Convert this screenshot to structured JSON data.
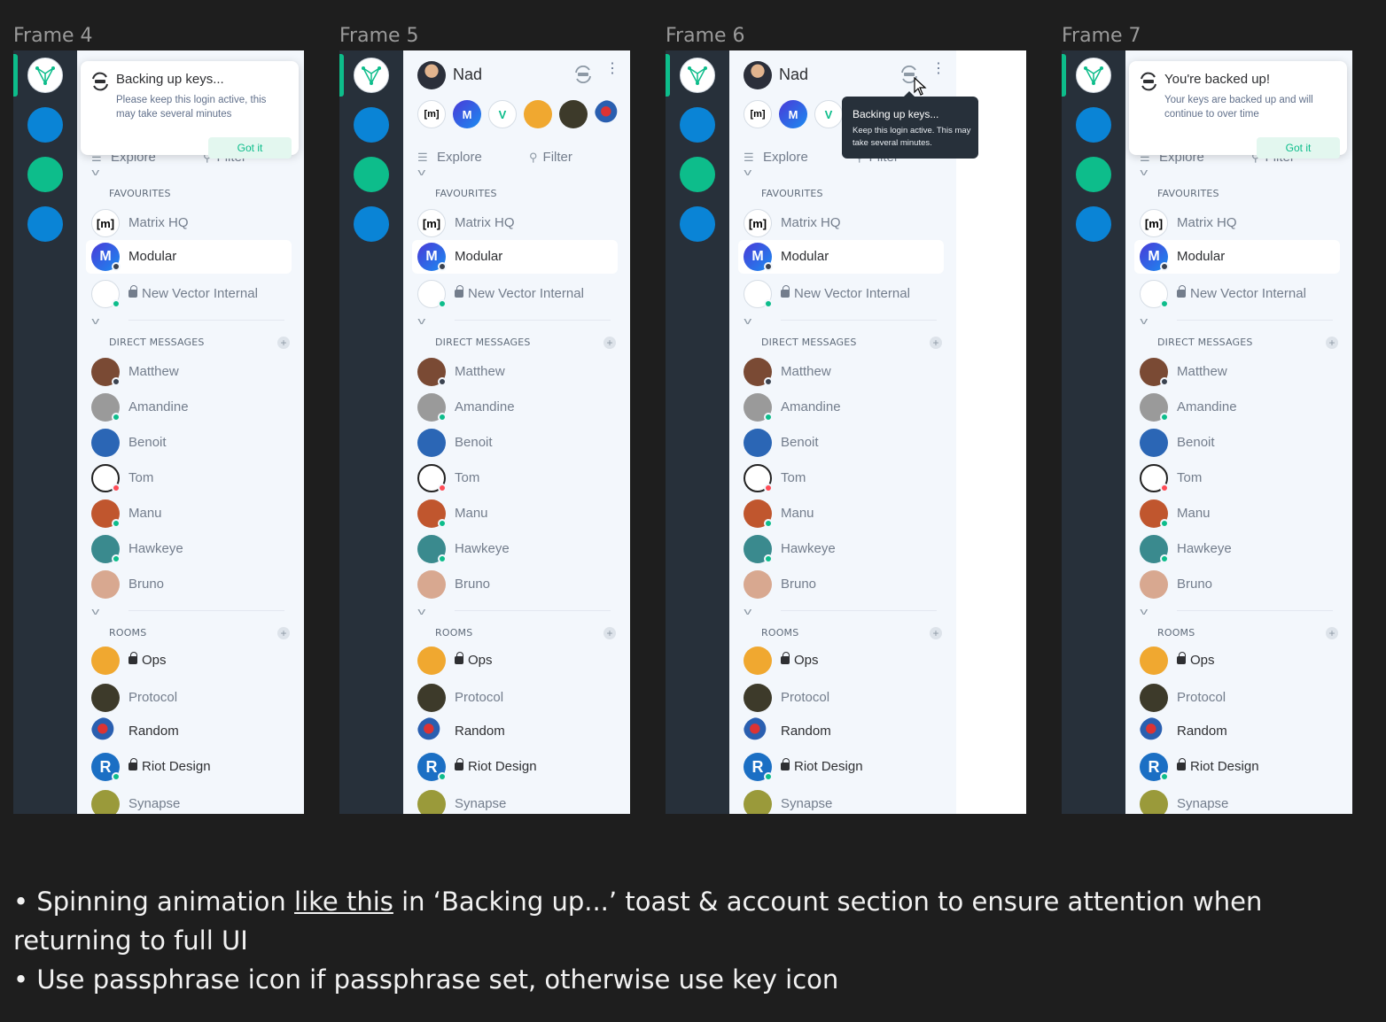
{
  "frames": [
    {
      "title": "Frame 4",
      "header_name": "",
      "toast": {
        "title": "Backing up keys...",
        "body": "Please keep this login active, this may take several minutes",
        "button": "Got it"
      }
    },
    {
      "title": "Frame 5",
      "header_name": "Nad"
    },
    {
      "title": "Frame 6",
      "header_name": "Nad",
      "tooltip": {
        "title": "Backing up keys...",
        "body": "Keep this login active. This may take several minutes."
      }
    },
    {
      "title": "Frame 7",
      "header_name": "",
      "toast": {
        "title": "You're backed up!",
        "body": "Your keys are backed up and will continue to over time",
        "button": "Got it"
      }
    }
  ],
  "panel": {
    "explore": "Explore",
    "filter": "Filter",
    "favourites": "FAVOURITES",
    "direct_messages": "DIRECT MESSAGES",
    "rooms": "ROOMS",
    "fav_items": [
      "Matrix HQ",
      "Modular",
      "New Vector Internal"
    ],
    "dm_items": [
      "Matthew",
      "Amandine",
      "Benoit",
      "Tom",
      "Manu",
      "Hawkeye",
      "Bruno"
    ],
    "room_items": [
      "Ops",
      "Protocol",
      "Random",
      "Riot Design",
      "Synapse"
    ]
  },
  "notes": {
    "line1_pre": "• Spinning animation ",
    "line1_link": "like this",
    "line1_post": " in ‘Backing up...’ toast & account section to ensure attention when returning to full UI",
    "line2": "• Use passphrase icon if passphrase set, otherwise use key icon"
  },
  "colors": {
    "background": "#1e1e1e",
    "rail": "#27303a",
    "panel": "#f3f7fc",
    "accent_green": "#0dbd8b",
    "space_blue": "#0a84d6",
    "space_green": "#0dbd8b"
  }
}
